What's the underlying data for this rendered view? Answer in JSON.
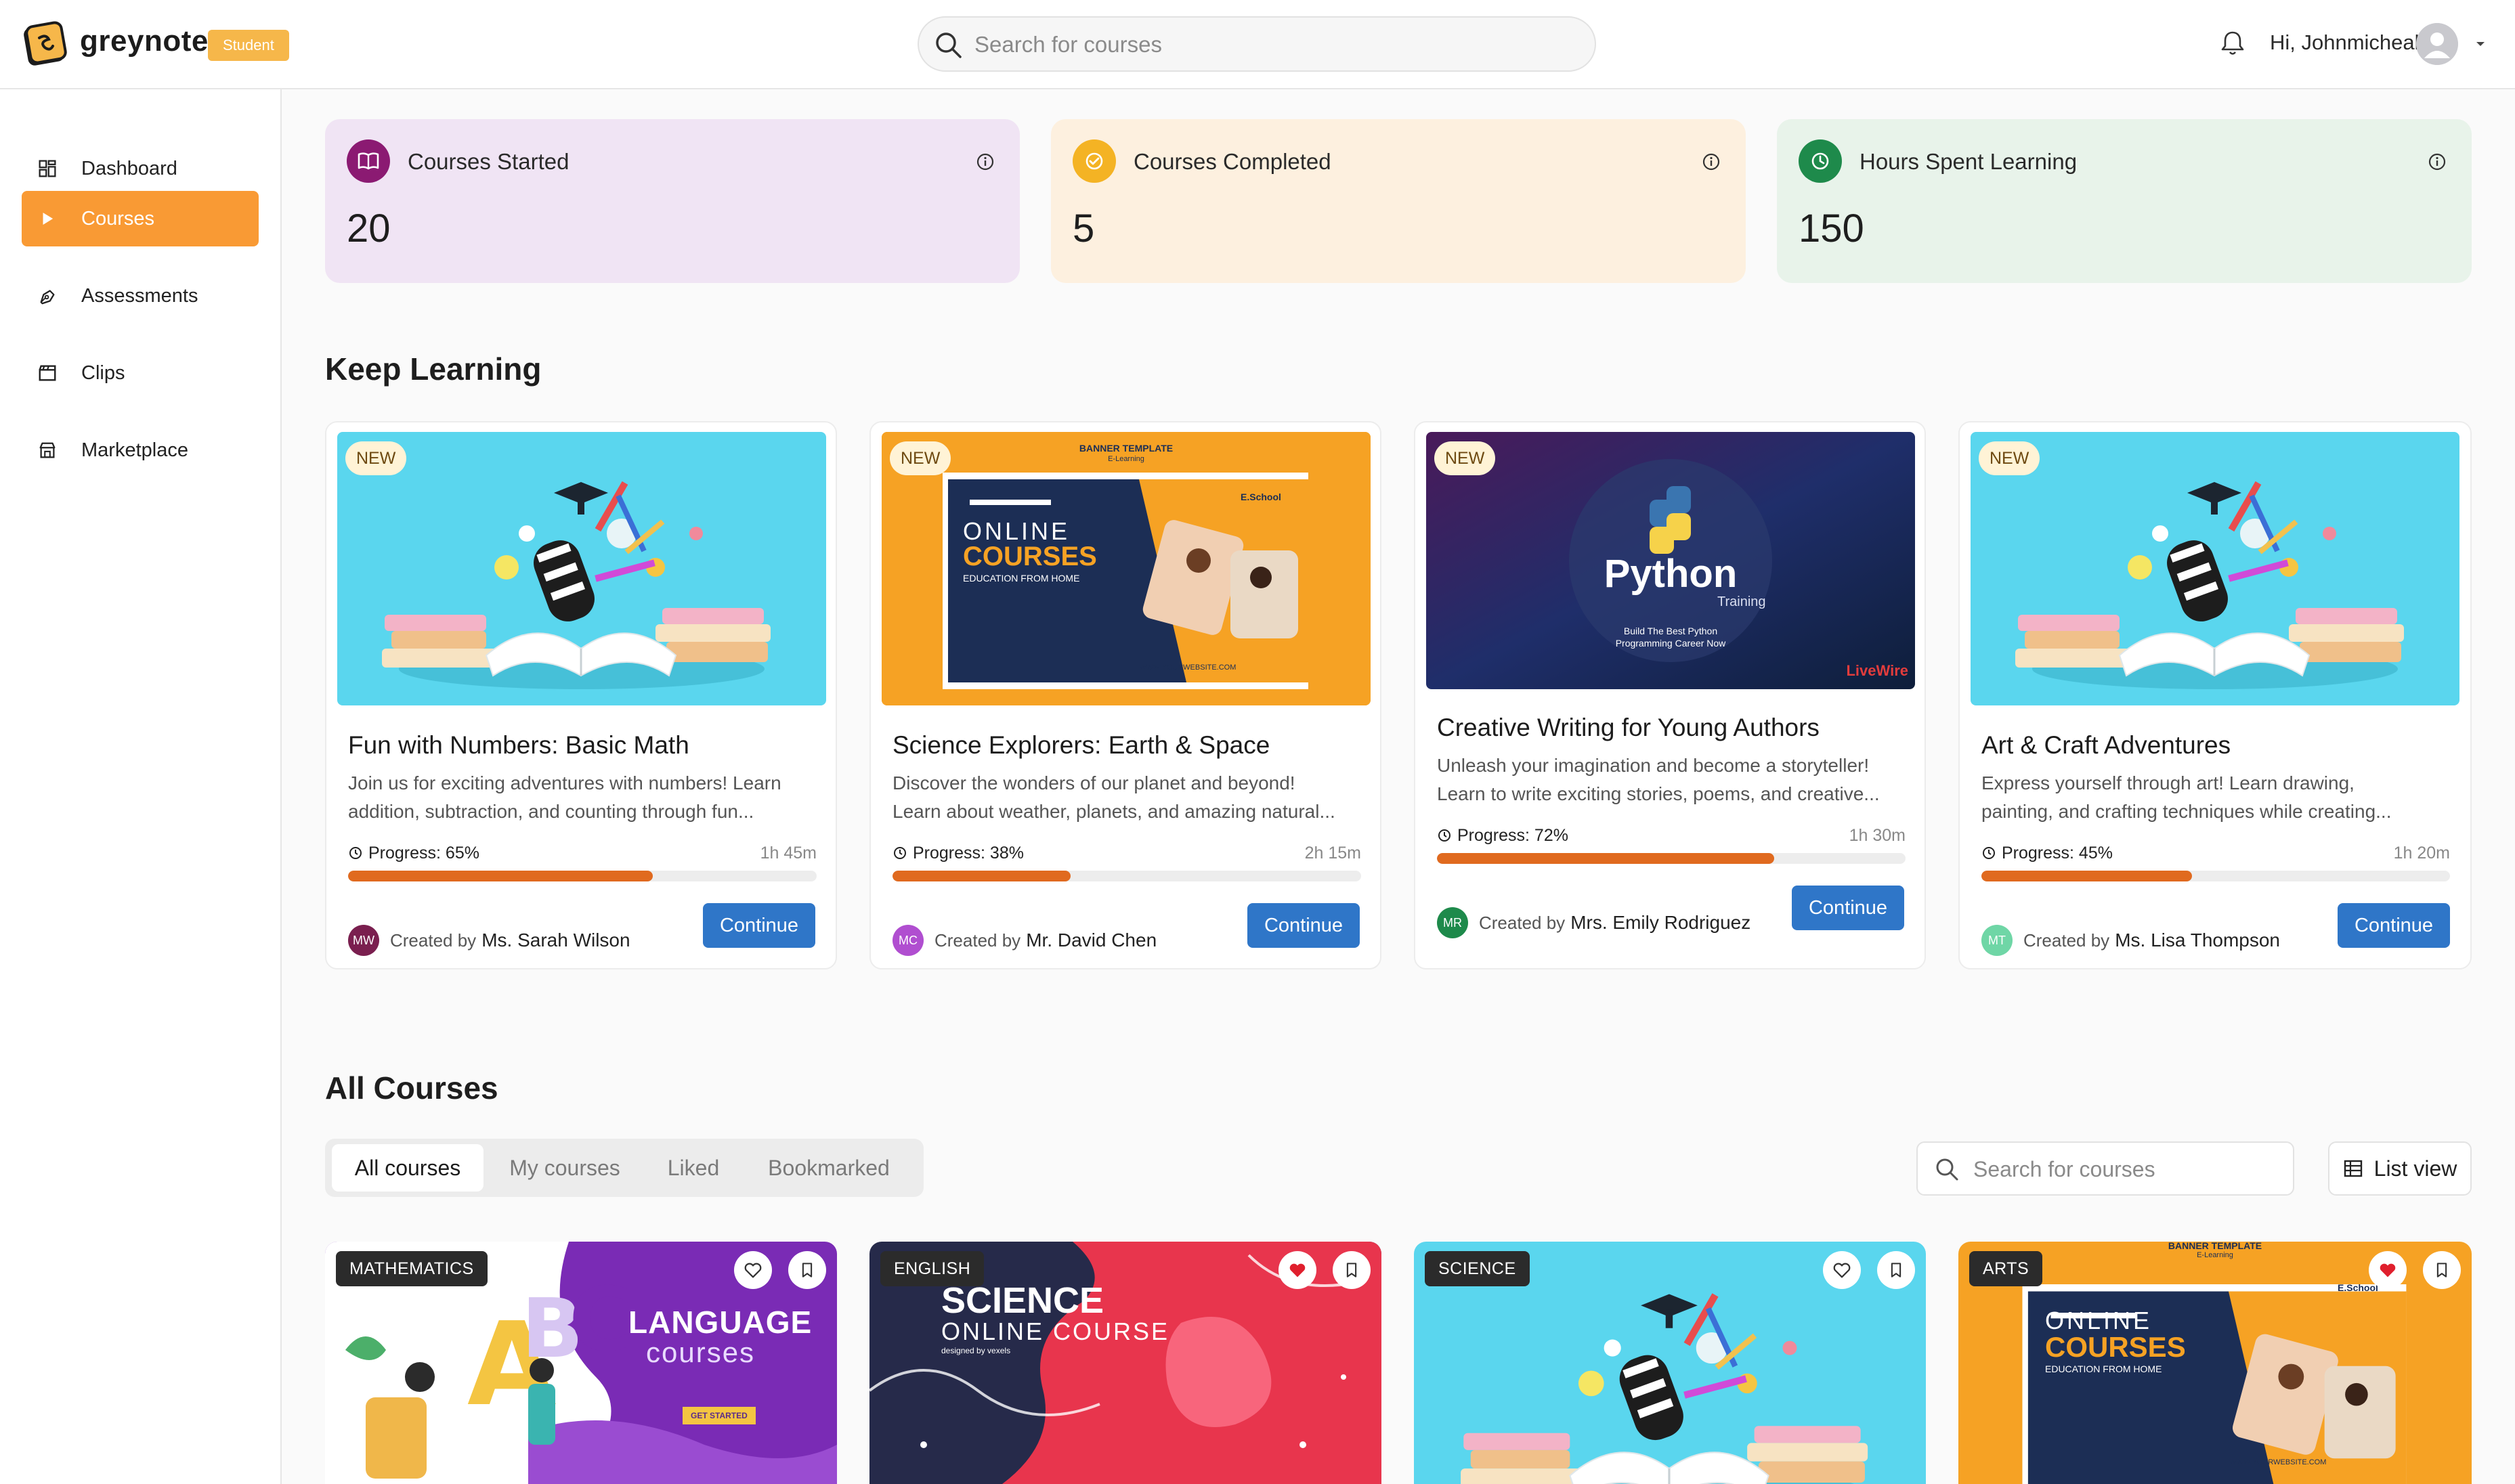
{
  "app": {
    "name": "greynote",
    "role_badge": "Student"
  },
  "header": {
    "search_placeholder": "Search for courses",
    "greeting": "Hi, Johnmicheal"
  },
  "sidebar": {
    "items": [
      {
        "label": "Dashboard",
        "icon": "dashboard-icon",
        "active": false
      },
      {
        "label": "Courses",
        "icon": "play-icon",
        "active": true
      },
      {
        "label": "Assessments",
        "icon": "pen-tool-icon",
        "active": false
      },
      {
        "label": "Clips",
        "icon": "clapperboard-icon",
        "active": false
      },
      {
        "label": "Marketplace",
        "icon": "store-icon",
        "active": false
      }
    ]
  },
  "stats": [
    {
      "label": "Courses Started",
      "value": "20",
      "icon": "book-open-icon",
      "bg": "#f0e4f4",
      "icon_bg": "#8b1a72"
    },
    {
      "label": "Courses Completed",
      "value": "5",
      "icon": "check-circle-icon",
      "bg": "#fdf0df",
      "icon_bg": "#f4b324"
    },
    {
      "label": "Hours Spent Learning",
      "value": "150",
      "icon": "clock-icon",
      "bg": "#e8f3ea",
      "icon_bg": "#1e8a4b"
    }
  ],
  "keep_learning": {
    "title": "Keep Learning",
    "courses": [
      {
        "badge": "NEW",
        "title": "Fun with Numbers: Basic Math",
        "desc1": "Join us for exciting adventures with numbers! Learn",
        "desc2": "addition, subtraction, and counting through fun...",
        "progress_label": "Progress: 65%",
        "progress": 0.65,
        "duration": "1h 45m",
        "author_initials": "MW",
        "author_color": "#7a1f4f",
        "created_by": "Created by",
        "author": "Ms. Sarah Wilson",
        "button": "Continue",
        "thumb": "books-3d"
      },
      {
        "badge": "NEW",
        "title": "Science Explorers: Earth & Space",
        "desc1": "Discover the wonders of our planet and beyond!",
        "desc2": "Learn about weather, planets, and amazing natural...",
        "progress_label": "Progress: 38%",
        "progress": 0.38,
        "duration": "2h 15m",
        "author_initials": "MC",
        "author_color": "#b04ed0",
        "created_by": "Created by",
        "author": "Mr. David Chen",
        "button": "Continue",
        "thumb": "online-courses-banner",
        "thumb_text": {
          "top": "BANNER TEMPLATE",
          "top_sub": "E-Learning",
          "line1": "ONLINE",
          "line2": "COURSES",
          "line3": "EDUCATION FROM HOME",
          "brand": "E.School",
          "url": "WWW.YOURWEBSITE.COM"
        }
      },
      {
        "badge": "NEW",
        "title": "Creative Writing for Young Authors",
        "desc1": "Unleash your imagination and become a storyteller!",
        "desc2": "Learn to write exciting stories, poems, and creative...",
        "progress_label": "Progress: 72%",
        "progress": 0.72,
        "duration": "1h 30m",
        "author_initials": "MR",
        "author_color": "#1e8a4b",
        "created_by": "Created by",
        "author": "Mrs. Emily Rodriguez",
        "button": "Continue",
        "thumb": "python-training",
        "thumb_text": {
          "title": "Python",
          "sub": "Training",
          "tag1": "Build The Best Python",
          "tag2": "Programming Career Now",
          "brand": "LiveWire"
        }
      },
      {
        "badge": "NEW",
        "title": "Art & Craft Adventures",
        "desc1": "Express yourself through art! Learn drawing,",
        "desc2": "painting, and crafting techniques while creating...",
        "progress_label": "Progress: 45%",
        "progress": 0.45,
        "duration": "1h 20m",
        "author_initials": "MT",
        "author_color": "#6fd6a6",
        "created_by": "Created by",
        "author": "Ms. Lisa Thompson",
        "button": "Continue",
        "thumb": "books-3d"
      }
    ]
  },
  "all_courses": {
    "title": "All Courses",
    "tabs": [
      "All courses",
      "My courses",
      "Liked",
      "Bookmarked"
    ],
    "active_tab": 0,
    "search_placeholder": "Search for courses",
    "view_toggle": "List view",
    "cards": [
      {
        "category": "MATHEMATICS",
        "liked": false,
        "thumb": "language-courses",
        "thumb_text": {
          "line1": "LANGUAGE",
          "line2": "courses",
          "cta": "GET STARTED"
        }
      },
      {
        "category": "ENGLISH",
        "liked": true,
        "thumb": "science-online",
        "thumb_text": {
          "line1": "SCIENCE",
          "line2": "ONLINE COURSE",
          "credit": "designed by vexels"
        }
      },
      {
        "category": "SCIENCE",
        "liked": false,
        "thumb": "books-3d"
      },
      {
        "category": "ARTS",
        "liked": true,
        "thumb": "online-courses-banner",
        "thumb_text": {
          "top": "BANNER TEMPLATE",
          "top_sub": "E-Learning",
          "line1": "ONLINE",
          "line2": "COURSES",
          "line3": "EDUCATION FROM HOME",
          "brand": "E.School",
          "url": "WWW.YOURWEBSITE.COM"
        }
      }
    ]
  },
  "colors": {
    "accent": "#f99a34",
    "primary_button": "#2f76c8",
    "progress_fill": "#e06a1f",
    "badge": "#f6b74a"
  }
}
